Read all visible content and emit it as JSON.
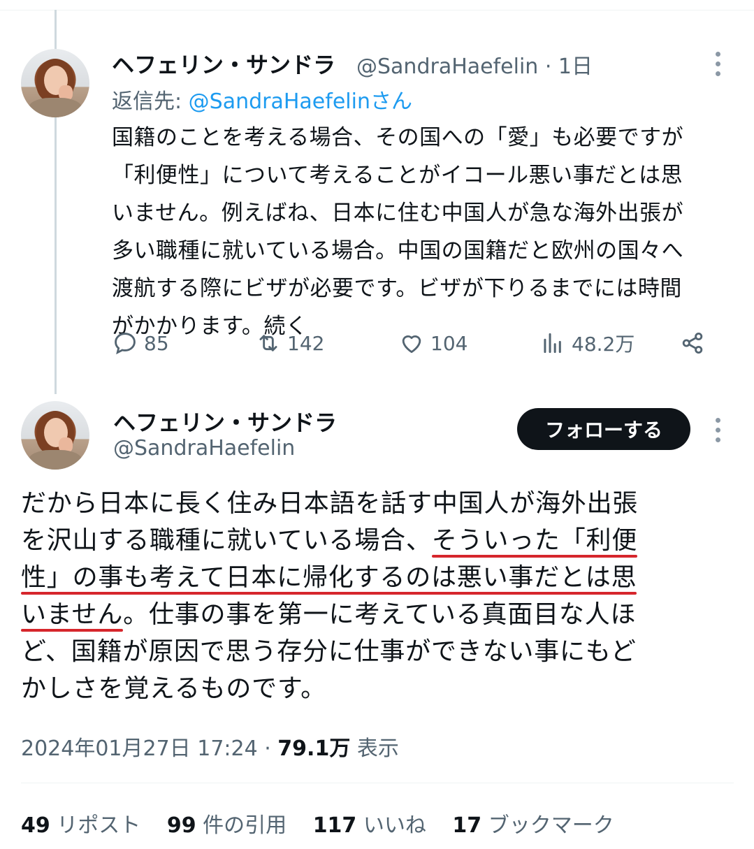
{
  "tweet1": {
    "name": "ヘフェリン・サンドラ",
    "handle": "@SandraHaefelin",
    "time": "· 1日",
    "reply_prefix": "返信先: ",
    "reply_to": "@SandraHaefelinさん",
    "lines": [
      "国籍のことを考える場合、その国への「愛」も必要ですが",
      "「利便性」について考えることがイコール悪い事だとは思",
      "いません。例えばね、日本に住む中国人が急な海外出張が",
      "多い職種に就いている場合。中国の国籍だと欧州の国々へ",
      "渡航する際にビザが必要です。ビザが下りるまでには時間",
      "がかかります。続く"
    ],
    "replies": "85",
    "reposts": "142",
    "likes": "104",
    "views": "48.2万",
    "icons": [
      "reply-icon",
      "repost-icon",
      "like-icon",
      "views-icon",
      "share-icon",
      "more-icon"
    ]
  },
  "tweet2": {
    "name": "ヘフェリン・サンドラ",
    "handle": "@SandraHaefelin",
    "follow_label": "フォローする",
    "line1": "だから日本に長く住み日本語を話す中国人が海外出張",
    "line2_plain": "を沢山する職種に就いている場合、",
    "line2_underlined": "そういった「利便",
    "line3_underlined": "性」の事も考えて日本に帰化するのは悪い事だとは思",
    "line4_underlined": "いません",
    "line4_plain": "。仕事の事を第一に考えている真面目な人ほ",
    "line5": "ど、国籍が原因で思う存分に仕事ができない事にもど",
    "line6": "かしさを覚えるものです。",
    "timestamp": "2024年01月27日 17:24 · ",
    "views_count": "79.1万",
    "views_label": " 表示",
    "reposts_count": "49",
    "reposts_label": " リポスト",
    "quotes_count": "99",
    "quotes_label": " 件の引用",
    "likes_count": "117",
    "likes_label": " いいね",
    "bookmarks_count": "17",
    "bookmarks_label": " ブックマーク",
    "underline_color": "#d6262c"
  },
  "colors": {
    "link": "#1d9bf0",
    "secondary_text": "#536471",
    "primary_text": "#0f1419"
  }
}
